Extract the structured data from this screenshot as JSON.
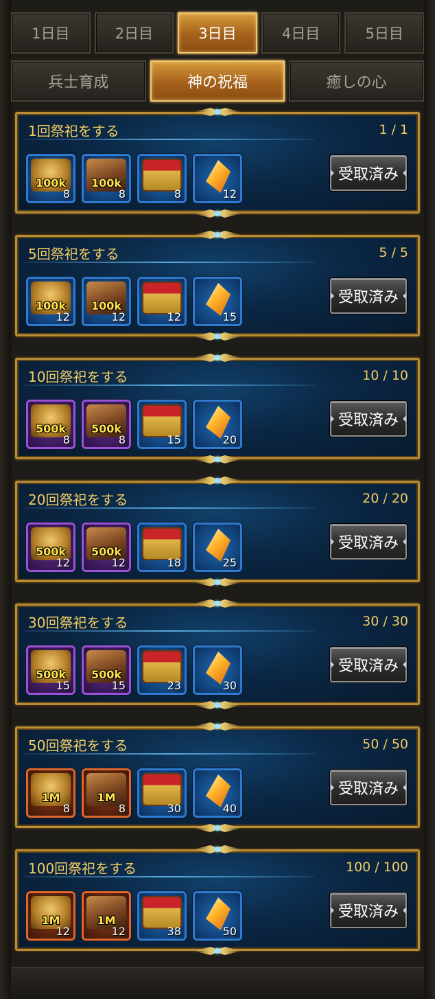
{
  "days": [
    {
      "label": "1日目"
    },
    {
      "label": "2日目"
    },
    {
      "label": "3日目",
      "active": true
    },
    {
      "label": "4日目"
    },
    {
      "label": "5日目"
    }
  ],
  "categories": [
    {
      "label": "兵士育成"
    },
    {
      "label": "神の祝福",
      "active": true
    },
    {
      "label": "癒しの心"
    }
  ],
  "claim_label": "受取済み",
  "tasks": [
    {
      "title": "1回祭祀をする",
      "progress": "1 / 1",
      "rewards": [
        {
          "icon": "wheat-icon",
          "rarity": "blue",
          "amount": "100k",
          "count": "8"
        },
        {
          "icon": "wood-icon",
          "rarity": "blue",
          "amount": "100k",
          "count": "8"
        },
        {
          "icon": "chest-icon",
          "rarity": "blue",
          "amount": "",
          "count": "8"
        },
        {
          "icon": "crystal-icon",
          "rarity": "blue",
          "amount": "",
          "count": "12"
        }
      ]
    },
    {
      "title": "5回祭祀をする",
      "progress": "5 / 5",
      "rewards": [
        {
          "icon": "wheat-icon",
          "rarity": "blue",
          "amount": "100k",
          "count": "12"
        },
        {
          "icon": "wood-icon",
          "rarity": "blue",
          "amount": "100k",
          "count": "12"
        },
        {
          "icon": "chest-icon",
          "rarity": "blue",
          "amount": "",
          "count": "12"
        },
        {
          "icon": "crystal-icon",
          "rarity": "blue",
          "amount": "",
          "count": "15"
        }
      ]
    },
    {
      "title": "10回祭祀をする",
      "progress": "10 / 10",
      "rewards": [
        {
          "icon": "wheat-icon",
          "rarity": "purple",
          "amount": "500k",
          "count": "8"
        },
        {
          "icon": "wood-icon",
          "rarity": "purple",
          "amount": "500k",
          "count": "8"
        },
        {
          "icon": "chest-icon",
          "rarity": "blue",
          "amount": "",
          "count": "15"
        },
        {
          "icon": "crystal-icon",
          "rarity": "blue",
          "amount": "",
          "count": "20"
        }
      ]
    },
    {
      "title": "20回祭祀をする",
      "progress": "20 / 20",
      "rewards": [
        {
          "icon": "wheat-icon",
          "rarity": "purple",
          "amount": "500k",
          "count": "12"
        },
        {
          "icon": "wood-icon",
          "rarity": "purple",
          "amount": "500k",
          "count": "12"
        },
        {
          "icon": "chest-icon",
          "rarity": "blue",
          "amount": "",
          "count": "18"
        },
        {
          "icon": "crystal-icon",
          "rarity": "blue",
          "amount": "",
          "count": "25"
        }
      ]
    },
    {
      "title": "30回祭祀をする",
      "progress": "30 / 30",
      "rewards": [
        {
          "icon": "wheat-icon",
          "rarity": "purple",
          "amount": "500k",
          "count": "15"
        },
        {
          "icon": "wood-icon",
          "rarity": "purple",
          "amount": "500k",
          "count": "15"
        },
        {
          "icon": "chest-icon",
          "rarity": "blue",
          "amount": "",
          "count": "23"
        },
        {
          "icon": "crystal-icon",
          "rarity": "blue",
          "amount": "",
          "count": "30"
        }
      ]
    },
    {
      "title": "50回祭祀をする",
      "progress": "50 / 50",
      "rewards": [
        {
          "icon": "wheat-icon",
          "rarity": "orange",
          "amount": "1M",
          "count": "8"
        },
        {
          "icon": "wood-icon",
          "rarity": "orange",
          "amount": "1M",
          "count": "8"
        },
        {
          "icon": "chest-icon",
          "rarity": "blue",
          "amount": "",
          "count": "30"
        },
        {
          "icon": "crystal-icon",
          "rarity": "blue",
          "amount": "",
          "count": "40"
        }
      ]
    },
    {
      "title": "100回祭祀をする",
      "progress": "100 / 100",
      "rewards": [
        {
          "icon": "wheat-icon",
          "rarity": "orange",
          "amount": "1M",
          "count": "12"
        },
        {
          "icon": "wood-icon",
          "rarity": "orange",
          "amount": "1M",
          "count": "12"
        },
        {
          "icon": "chest-icon",
          "rarity": "blue",
          "amount": "",
          "count": "38"
        },
        {
          "icon": "crystal-icon",
          "rarity": "blue",
          "amount": "",
          "count": "50"
        }
      ]
    }
  ]
}
